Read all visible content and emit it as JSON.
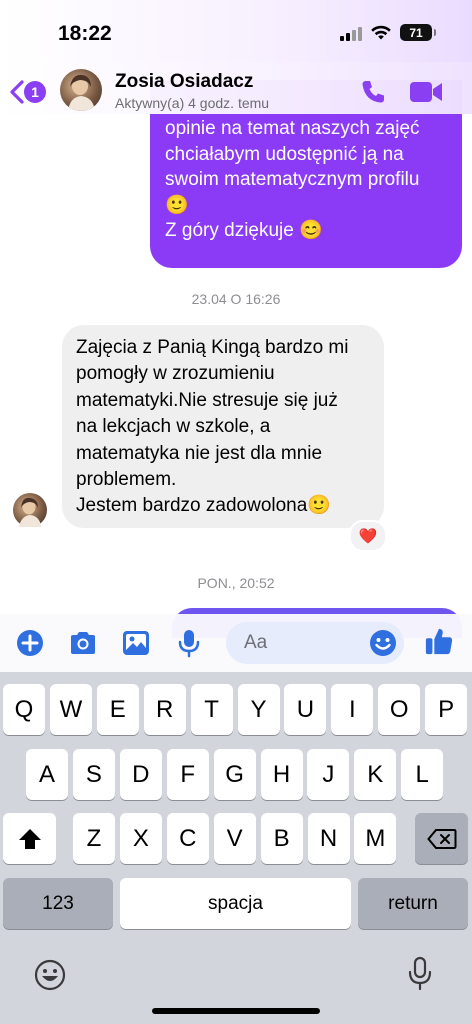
{
  "status_bar": {
    "time": "18:22",
    "battery": "71"
  },
  "header": {
    "back_count": "1",
    "contact_name": "Zosia Osiadacz",
    "contact_status": "Aktywny(a) 4 godz. temu",
    "icons": [
      "chevron-left-icon",
      "phone-icon",
      "video-camera-icon"
    ]
  },
  "messages": {
    "outgoing_partial": {
      "lines": [
        "opinie na temat naszych zajęć",
        "chciałabym udostępnić ją na",
        "swoim matematycznym profilu",
        "🙂",
        " Z góry dziękuje 😊"
      ]
    },
    "timestamp_1": "23.04 O 16:26",
    "incoming": {
      "lines": [
        "Zajęcia z Panią Kingą bardzo mi",
        "pomogły w zrozumieniu",
        "matematyki.Nie stresuje się już",
        "na lekcjach w szkole, a",
        "matematyka nie jest dla mnie",
        "problemem.",
        "Jestem bardzo zadowolona🙂"
      ],
      "reaction": "❤️"
    },
    "timestamp_2": "PON., 20:52"
  },
  "composer": {
    "placeholder": "Aa",
    "icons": [
      "plus-icon",
      "camera-icon",
      "image-icon",
      "microphone-icon",
      "emoji-icon",
      "thumbs-up-icon"
    ]
  },
  "keyboard": {
    "row1": [
      "Q",
      "W",
      "E",
      "R",
      "T",
      "Y",
      "U",
      "I",
      "O",
      "P"
    ],
    "row2": [
      "A",
      "S",
      "D",
      "F",
      "G",
      "H",
      "J",
      "K",
      "L"
    ],
    "row3": [
      "Z",
      "X",
      "C",
      "V",
      "B",
      "N",
      "M"
    ],
    "numbers_key": "123",
    "space_key": "spacja",
    "return_key": "return"
  },
  "colors": {
    "accent_purple": "#8b3bf5",
    "messenger_blue": "#2f6fe0",
    "incoming_bubble": "#efeff0"
  }
}
